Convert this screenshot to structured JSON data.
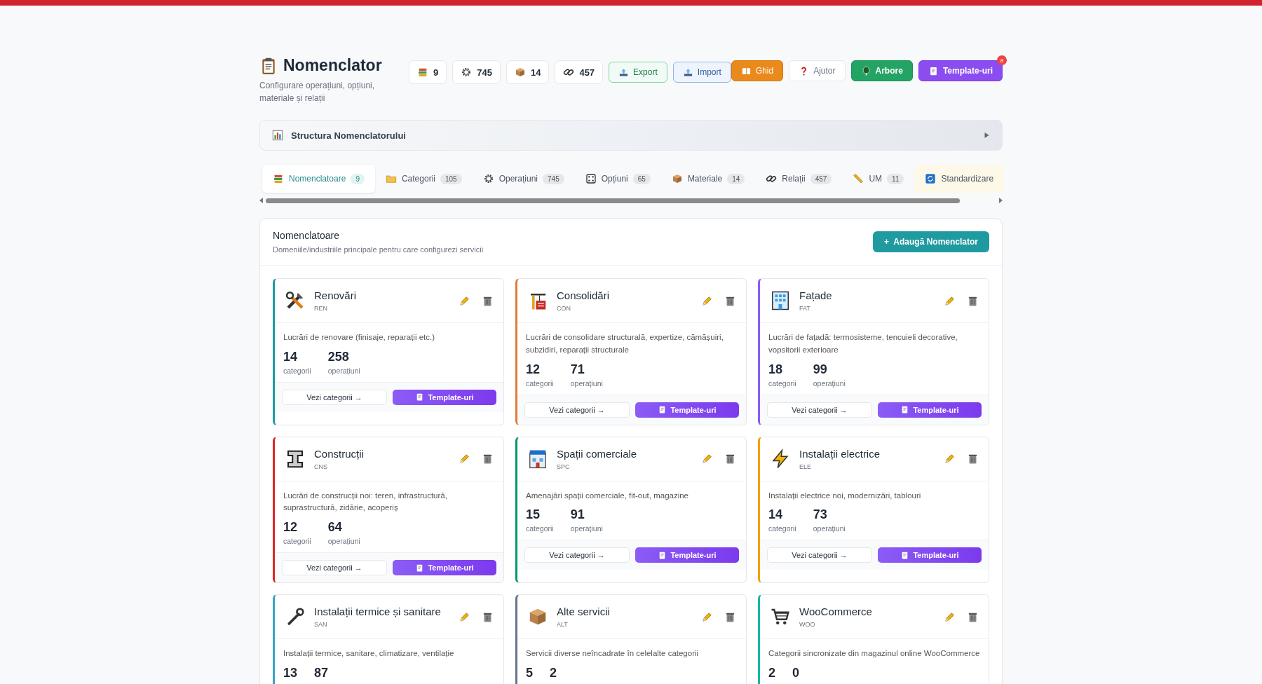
{
  "header": {
    "title": "Nomenclator",
    "subtitle": "Configurare operațiuni, opțiuni, materiale și relații"
  },
  "stats": [
    {
      "value": "9"
    },
    {
      "value": "745"
    },
    {
      "value": "14"
    },
    {
      "value": "457"
    }
  ],
  "actions": [
    {
      "label": "Export",
      "kind": "export"
    },
    {
      "label": "Import",
      "kind": "import"
    },
    {
      "label": "Ghid",
      "kind": "guide"
    },
    {
      "label": "Ajutor",
      "kind": "help"
    },
    {
      "label": "Arbore",
      "kind": "tree"
    },
    {
      "label": "Template-uri",
      "kind": "templates",
      "badge": "8"
    }
  ],
  "structure_panel": {
    "title": "Structura Nomenclatorului",
    "expanded": false
  },
  "tabs": [
    {
      "label": "Nomenclatoare",
      "count": "9",
      "selected": true,
      "highlighted": false
    },
    {
      "label": "Categorii",
      "count": "105",
      "selected": false,
      "highlighted": false
    },
    {
      "label": "Operațiuni",
      "count": "745",
      "selected": false,
      "highlighted": false
    },
    {
      "label": "Opțiuni",
      "count": "65",
      "selected": false,
      "highlighted": false
    },
    {
      "label": "Materiale",
      "count": "14",
      "selected": false,
      "highlighted": false
    },
    {
      "label": "Relații",
      "count": "457",
      "selected": false,
      "highlighted": false
    },
    {
      "label": "UM",
      "count": "11",
      "selected": false,
      "highlighted": false
    },
    {
      "label": "Standardizare",
      "selected": false,
      "highlighted": true
    }
  ],
  "section": {
    "title": "Nomenclatoare",
    "subtitle": "Domeniile/industriile principale pentru care configurezi servicii",
    "add_button": "+  Adaugă Nomenclator"
  },
  "cards": [
    {
      "title": "Renovări",
      "code": "REN",
      "color": "#1a9ba0",
      "description": "Lucrări de renovare (finisaje, reparații etc.)",
      "categories": "14",
      "categories_label": "categorii",
      "operations": "258",
      "operations_label": "operațiuni",
      "view_button": "Vezi categorii →",
      "templates_button": "Template-uri"
    },
    {
      "title": "Consolidări",
      "code": "CON",
      "color": "#e07b39",
      "description": "Lucrări de consolidare structurală, expertize, cămășuiri, subzidiri, reparații structurale",
      "categories": "12",
      "categories_label": "categorii",
      "operations": "71",
      "operations_label": "operațiuni",
      "view_button": "Vezi categorii →",
      "templates_button": "Template-uri"
    },
    {
      "title": "Fațade",
      "code": "FAT",
      "color": "#8b5cf6",
      "description": "Lucrări de fațadă: termosisteme, tencuieli decorative, vopsitorii exterioare",
      "categories": "18",
      "categories_label": "categorii",
      "operations": "99",
      "operations_label": "operațiuni",
      "view_button": "Vezi categorii →",
      "templates_button": "Template-uri"
    },
    {
      "title": "Construcții",
      "code": "CNS",
      "color": "#dc2626",
      "description": "Lucrări de construcții noi: teren, infrastructură, suprastructură, zidărie, acoperiș",
      "categories": "12",
      "categories_label": "categorii",
      "operations": "64",
      "operations_label": "operațiuni",
      "view_button": "Vezi categorii →",
      "templates_button": "Template-uri"
    },
    {
      "title": "Spații comerciale",
      "code": "SPC",
      "color": "#059669",
      "description": "Amenajări spații comerciale, fit-out, magazine",
      "categories": "15",
      "categories_label": "categorii",
      "operations": "91",
      "operations_label": "operațiuni",
      "view_button": "Vezi categorii →",
      "templates_button": "Template-uri"
    },
    {
      "title": "Instalații electrice",
      "code": "ELE",
      "color": "#f59e0b",
      "description": "Instalații electrice noi, modernizări, tablouri",
      "categories": "14",
      "categories_label": "categorii",
      "operations": "73",
      "operations_label": "operațiuni",
      "view_button": "Vezi categorii →",
      "templates_button": "Template-uri"
    },
    {
      "title": "Instalații termice și sanitare",
      "code": "SAN",
      "color": "#38a3c6",
      "description": "Instalații termice, sanitare, climatizare, ventilație",
      "categories": "13",
      "operations": "87"
    },
    {
      "title": "Alte servicii",
      "code": "ALT",
      "color": "#64748b",
      "description": "Servicii diverse neîncadrate în celelalte categorii",
      "categories": "5",
      "operations": "2"
    },
    {
      "title": "WooCommerce",
      "code": "WOO",
      "color": "#14b8a6",
      "description": "Categorii sincronizate din magazinul online WooCommerce",
      "categories": "2",
      "operations": "0"
    }
  ]
}
